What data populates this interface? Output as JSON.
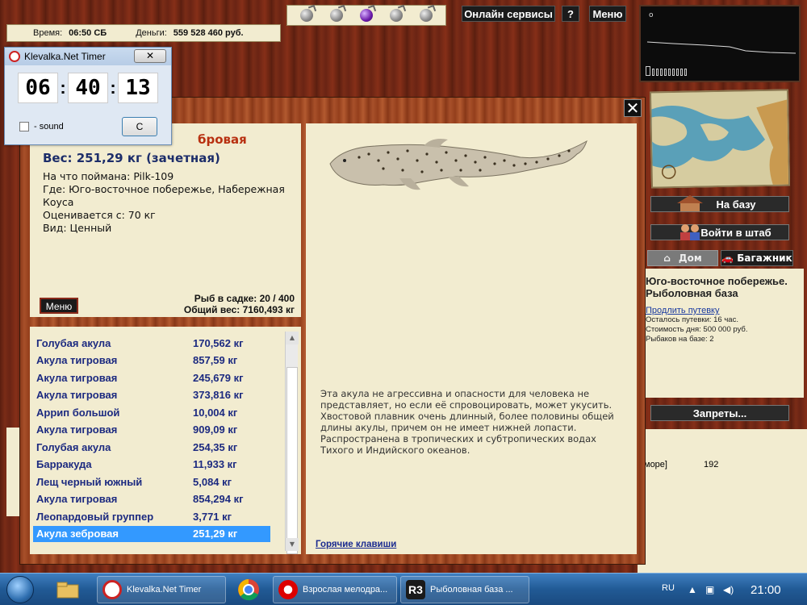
{
  "topbar": {
    "time_label": "Время:",
    "time_value": "06:50 СБ",
    "money_label": "Деньги:",
    "money_value": "559 528 460 руб.",
    "online_label": "Онлайн сервисы",
    "help_label": "?",
    "menu_label": "Меню"
  },
  "graph": {
    "degree_mark": "o"
  },
  "right": {
    "base_label": "На базу",
    "hq_label": "Войти в штаб",
    "home_label": "Дом",
    "trunk_label": "Багажник",
    "location_title": "Юго-восточное побережье. Рыболовная база",
    "extend_link": "Продлить путевку",
    "lines": [
      "Осталось путевки: 16 час.",
      "Стоимость дня: 500 000 руб.",
      "Рыбаков на базе: 2"
    ],
    "bans_label": "Запреты...",
    "lower_text_a": "море]",
    "lower_text_b": "192"
  },
  "timer": {
    "title": "Klevalka.Net Timer",
    "close": "✕",
    "hh": "06",
    "mm": "40",
    "ss": "13",
    "sound_label": "- sound",
    "c_label": "С"
  },
  "dialog": {
    "close": "✕",
    "fish_name_partial": "бровая",
    "weight": "Вес: 251,29 кг (зачетная)",
    "caught_on": "На что поймана: Pilk-109",
    "where": "Где: Юго-восточное побережье, Набережная Коуса",
    "valued_from": "Оценивается с: 70 кг",
    "kind": "Вид: Ценный",
    "menu_label": "Меню",
    "keep_count": "Рыб в садке: 20 / 400",
    "total_weight": "Общий вес: 7160,493 кг",
    "description": "Эта акула не агрессивна и опасности для человека не представляет, но если её спровоцировать, может укусить. Хвостовой плавник очень длинный, более половины общей длины акулы, причем он не имеет нижней лопасти. Распространена в тропических и субтропических водах Тихого и Индийского океанов.",
    "hotkeys": "Горячие клавиши",
    "fish_list": [
      {
        "name": "Голубая акула",
        "weight": "170,562 кг"
      },
      {
        "name": "Акула тигровая",
        "weight": "857,59 кг"
      },
      {
        "name": "Акула тигровая",
        "weight": "245,679 кг"
      },
      {
        "name": "Акула тигровая",
        "weight": "373,816 кг"
      },
      {
        "name": "Аррип большой",
        "weight": "10,004 кг"
      },
      {
        "name": "Акула тигровая",
        "weight": "909,09 кг"
      },
      {
        "name": "Голубая акула",
        "weight": "254,35 кг"
      },
      {
        "name": "Барракуда",
        "weight": "11,933 кг"
      },
      {
        "name": "Лещ черный южный",
        "weight": "5,084 кг"
      },
      {
        "name": "Акула тигровая",
        "weight": "854,294 кг"
      },
      {
        "name": "Леопардовый группер",
        "weight": "3,771 кг"
      },
      {
        "name": "Акула зебровая",
        "weight": "251,29 кг"
      }
    ],
    "selected_index": 11
  },
  "taskbar": {
    "tasks": [
      {
        "label": "Klevalka.Net Timer"
      },
      {
        "label": "Взрослая мелодра..."
      },
      {
        "label": "Рыболовная база ..."
      }
    ],
    "lang": "RU",
    "clock": "21:00"
  },
  "colors": {
    "panel_bg": "#f2ecd0",
    "list_text": "#1c2a80",
    "fish_name": "#b83010",
    "selection": "#3399ff"
  }
}
